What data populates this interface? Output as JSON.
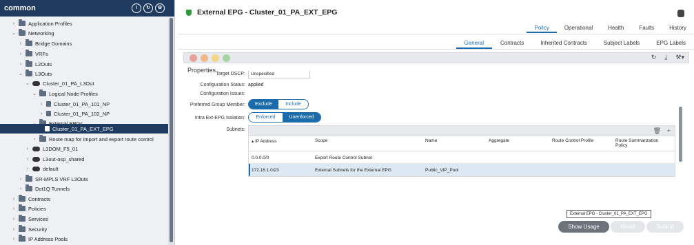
{
  "sidebar": {
    "title": "common",
    "items": [
      {
        "label": "Application Profiles",
        "expanded": false
      },
      {
        "label": "Networking",
        "expanded": true
      },
      {
        "label": "Bridge Domains",
        "expanded": false
      },
      {
        "label": "VRFs",
        "expanded": false
      },
      {
        "label": "L2Outs",
        "expanded": false
      },
      {
        "label": "L3Outs",
        "expanded": true
      },
      {
        "label": "Cluster_01_PA_L3Out",
        "expanded": true
      },
      {
        "label": "Logical Node Profiles",
        "expanded": true
      },
      {
        "label": "Cluster_01_PA_101_NP",
        "expanded": false
      },
      {
        "label": "Cluster_01_PA_102_NP",
        "expanded": false
      },
      {
        "label": "External EPGs",
        "expanded": true
      },
      {
        "label": "Cluster_01_PA_EXT_EPG",
        "selected": true
      },
      {
        "label": "Route map for import and export route control",
        "expanded": false
      },
      {
        "label": "L3DOM_F5_01",
        "expanded": false
      },
      {
        "label": "L3out-osp_shared",
        "expanded": false
      },
      {
        "label": "default",
        "expanded": false
      },
      {
        "label": "SR-MPLS VRF L3Outs",
        "expanded": false
      },
      {
        "label": "Dot1Q Tunnels",
        "expanded": false
      },
      {
        "label": "Contracts",
        "expanded": false
      },
      {
        "label": "Policies",
        "expanded": false
      },
      {
        "label": "Services",
        "expanded": false
      },
      {
        "label": "Security",
        "expanded": false
      },
      {
        "label": "IP Address Pools",
        "expanded": false
      }
    ]
  },
  "header": {
    "title": "External EPG - Cluster_01_PA_EXT_EPG",
    "tabs": [
      "Policy",
      "Operational",
      "Health",
      "Faults",
      "History"
    ],
    "active_tab": "Policy",
    "subtabs": [
      "General",
      "Contracts",
      "Inherited Contracts",
      "Subject Labels",
      "EPG Labels"
    ],
    "active_subtab": "General"
  },
  "properties": {
    "heading": "Properties",
    "target_dscp_label": "Target DSCP:",
    "target_dscp_value": "Unspecified",
    "config_status_label": "Configuration Status:",
    "config_status_value": "applied",
    "config_issues_label": "Configuration Issues:",
    "preferred_group_label": "Preferred Group Member:",
    "preferred_exclude": "Exclude",
    "preferred_include": "Include",
    "preferred_selected": "Exclude",
    "isolation_label": "Intra Ext-EPG Isolation:",
    "isolation_enforced": "Enforced",
    "isolation_unenforced": "Unenforced",
    "isolation_selected": "Unenforced",
    "subnets_label": "Subnets:"
  },
  "subnets": {
    "columns": [
      "▴ IP Address",
      "Scope",
      "Name",
      "Aggregate",
      "Route Control Profile",
      "Route Summarization Policy"
    ],
    "rows": [
      {
        "ip": "0.0.0.0/0",
        "scope": "Export Route Control Subnet",
        "name": "",
        "aggregate": "",
        "rcp": "",
        "rsp": ""
      },
      {
        "ip": "172.16.1.0/23",
        "scope": "External Subnets for the External EPG",
        "name": "Public_VIP_Pool",
        "aggregate": "",
        "rcp": "",
        "rsp": ""
      }
    ]
  },
  "footer": {
    "tooltip": "External EPG - Cluster_01_PA_EXT_EPG",
    "show_usage": "Show Usage",
    "reset": "Reset",
    "submit": "Submit"
  },
  "colors": {
    "sidebar_header": "#1e3a5f",
    "accent": "#1b6bab",
    "selection": "#dce9f5"
  }
}
